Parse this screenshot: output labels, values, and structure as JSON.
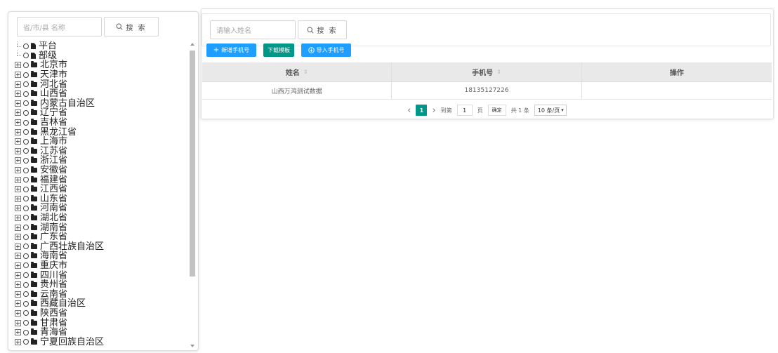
{
  "left": {
    "search_placeholder": "省/市/县 名称",
    "search_button": "搜 索",
    "tree": [
      {
        "label": "平台",
        "type": "file",
        "expandable": false
      },
      {
        "label": "部级",
        "type": "file",
        "expandable": false
      },
      {
        "label": "北京市",
        "type": "folder",
        "expandable": true
      },
      {
        "label": "天津市",
        "type": "folder",
        "expandable": true
      },
      {
        "label": "河北省",
        "type": "folder",
        "expandable": true
      },
      {
        "label": "山西省",
        "type": "folder",
        "expandable": true
      },
      {
        "label": "内蒙古自治区",
        "type": "folder",
        "expandable": true
      },
      {
        "label": "辽宁省",
        "type": "folder",
        "expandable": true
      },
      {
        "label": "吉林省",
        "type": "folder",
        "expandable": true
      },
      {
        "label": "黑龙江省",
        "type": "folder",
        "expandable": true
      },
      {
        "label": "上海市",
        "type": "folder",
        "expandable": true
      },
      {
        "label": "江苏省",
        "type": "folder",
        "expandable": true
      },
      {
        "label": "浙江省",
        "type": "folder",
        "expandable": true
      },
      {
        "label": "安徽省",
        "type": "folder",
        "expandable": true
      },
      {
        "label": "福建省",
        "type": "folder",
        "expandable": true
      },
      {
        "label": "江西省",
        "type": "folder",
        "expandable": true
      },
      {
        "label": "山东省",
        "type": "folder",
        "expandable": true
      },
      {
        "label": "河南省",
        "type": "folder",
        "expandable": true
      },
      {
        "label": "湖北省",
        "type": "folder",
        "expandable": true
      },
      {
        "label": "湖南省",
        "type": "folder",
        "expandable": true
      },
      {
        "label": "广东省",
        "type": "folder",
        "expandable": true
      },
      {
        "label": "广西壮族自治区",
        "type": "folder",
        "expandable": true
      },
      {
        "label": "海南省",
        "type": "folder",
        "expandable": true
      },
      {
        "label": "重庆市",
        "type": "folder",
        "expandable": true
      },
      {
        "label": "四川省",
        "type": "folder",
        "expandable": true
      },
      {
        "label": "贵州省",
        "type": "folder",
        "expandable": true
      },
      {
        "label": "云南省",
        "type": "folder",
        "expandable": true
      },
      {
        "label": "西藏自治区",
        "type": "folder",
        "expandable": true
      },
      {
        "label": "陕西省",
        "type": "folder",
        "expandable": true
      },
      {
        "label": "甘肃省",
        "type": "folder",
        "expandable": true
      },
      {
        "label": "青海省",
        "type": "folder",
        "expandable": true
      },
      {
        "label": "宁夏回族自治区",
        "type": "folder",
        "expandable": true
      }
    ]
  },
  "right": {
    "search_placeholder": "请输入姓名",
    "search_button": "搜 索",
    "toolbar": {
      "add_label": "新增手机号",
      "download_label": "下载模板",
      "import_label": "导入手机号"
    },
    "table": {
      "columns": [
        "姓名",
        "手机号",
        "操作"
      ],
      "rows": [
        [
          "山西万鸿测试数据",
          "18135127226",
          ""
        ]
      ]
    },
    "pager": {
      "current_page": "1",
      "goto_label": "到第",
      "goto_value": "1",
      "page_unit": "页",
      "confirm_label": "确定",
      "total_label": "共 1 条",
      "page_size": "10 条/页"
    }
  },
  "colors": {
    "accent_blue": "#1e9fff",
    "accent_green": "#009688",
    "header_bg": "#e9e9e9"
  }
}
